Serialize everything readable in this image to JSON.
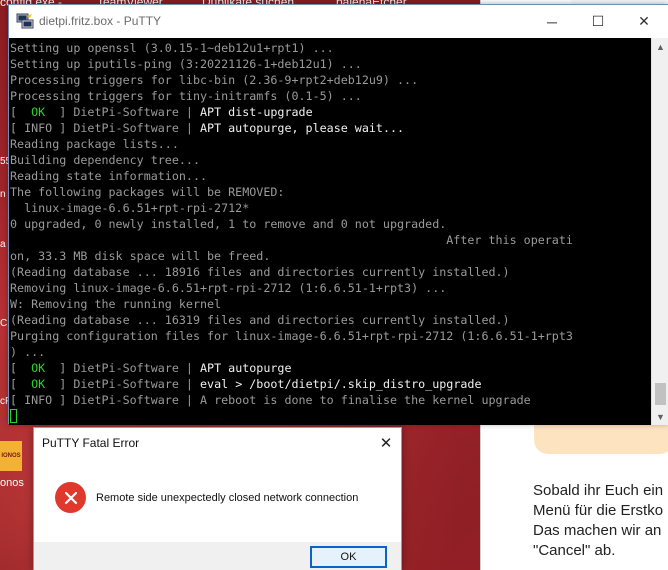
{
  "desktop": {
    "top_labels": [
      "config.exe -",
      "TeamViewer",
      "Duplikate suchen",
      "balenaEtcher"
    ],
    "left_icon_text": "IONOS",
    "left_icon_label": "onos",
    "left_fragments": [
      "55",
      "n",
      "a",
      "C",
      "cF"
    ],
    "right_panel_lines": [
      "Sobald ihr Euch ein",
      "Menü für die Erstko",
      "Das machen wir an",
      "\"Cancel\" ab."
    ]
  },
  "putty": {
    "title": "dietpi.fritz.box - PuTTY",
    "controls": {
      "minimize": "─",
      "maximize": "☐",
      "close": "✕"
    },
    "lines": [
      [
        {
          "t": "Setting up openssl (3.0.15-1~deb12u1+rpt1) ...",
          "c": "dim"
        }
      ],
      [
        {
          "t": "Setting up iputils-ping (3:20221126-1+deb12u1) ...",
          "c": "dim"
        }
      ],
      [
        {
          "t": "Processing triggers for libc-bin (2.36-9+rpt2+deb12u9) ...",
          "c": "dim"
        }
      ],
      [
        {
          "t": "Processing triggers for tiny-initramfs (0.1-5) ...",
          "c": "dim"
        }
      ],
      [
        {
          "t": "[  ",
          "c": "dim"
        },
        {
          "t": "OK",
          "c": "ok"
        },
        {
          "t": "  ] DietPi-Software | ",
          "c": "dim"
        },
        {
          "t": "APT dist-upgrade",
          "c": "bright"
        }
      ],
      [
        {
          "t": "[ INFO ] DietPi-Software | ",
          "c": "dim"
        },
        {
          "t": "APT autopurge, please wait...",
          "c": "bright"
        }
      ],
      [
        {
          "t": "Reading package lists...",
          "c": "dim"
        }
      ],
      [
        {
          "t": "Building dependency tree...",
          "c": "dim"
        }
      ],
      [
        {
          "t": "Reading state information...",
          "c": "dim"
        }
      ],
      [
        {
          "t": "The following packages will be REMOVED:",
          "c": "dim"
        }
      ],
      [
        {
          "t": "  linux-image-6.6.51+rpt-rpi-2712*",
          "c": "dim"
        }
      ],
      [
        {
          "t": "0 upgraded, 0 newly installed, 1 to remove and 0 not upgraded.",
          "c": "dim"
        }
      ],
      [
        {
          "t": "                                                              After this operati",
          "c": "dim"
        }
      ],
      [
        {
          "t": "on, 33.3 MB disk space will be freed.",
          "c": "dim"
        }
      ],
      [
        {
          "t": "(Reading database ... 18916 files and directories currently installed.)",
          "c": "dim"
        }
      ],
      [
        {
          "t": "Removing linux-image-6.6.51+rpt-rpi-2712 (1:6.6.51-1+rpt3) ...",
          "c": "dim"
        }
      ],
      [
        {
          "t": "W: Removing the running kernel",
          "c": "dim"
        }
      ],
      [
        {
          "t": "(Reading database ... 16319 files and directories currently installed.)",
          "c": "dim"
        }
      ],
      [
        {
          "t": "Purging configuration files for linux-image-6.6.51+rpt-rpi-2712 (1:6.6.51-1+rpt3",
          "c": "dim"
        }
      ],
      [
        {
          "t": ") ...",
          "c": "dim"
        }
      ],
      [
        {
          "t": "[  ",
          "c": "dim"
        },
        {
          "t": "OK",
          "c": "ok"
        },
        {
          "t": "  ] DietPi-Software | ",
          "c": "dim"
        },
        {
          "t": "APT autopurge",
          "c": "bright"
        }
      ],
      [
        {
          "t": "[  ",
          "c": "dim"
        },
        {
          "t": "OK",
          "c": "ok"
        },
        {
          "t": "  ] DietPi-Software | ",
          "c": "dim"
        },
        {
          "t": "eval > /boot/dietpi/.skip_distro_upgrade",
          "c": "bright"
        }
      ],
      [
        {
          "t": "[ INFO ] DietPi-Software | ",
          "c": "dim"
        },
        {
          "t": "A reboot is done to finalise the kernel upgrade",
          "c": "dim"
        }
      ]
    ]
  },
  "dialog": {
    "title": "PuTTY Fatal Error",
    "message": "Remote side unexpectedly closed network connection",
    "ok_label": "OK",
    "close_glyph": "✕"
  },
  "colors": {
    "term_bg": "#000000",
    "term_text": "#bbbbbb",
    "ok_green": "#25d625",
    "error_red": "#e0382c",
    "focus_blue": "#0a64c8"
  }
}
